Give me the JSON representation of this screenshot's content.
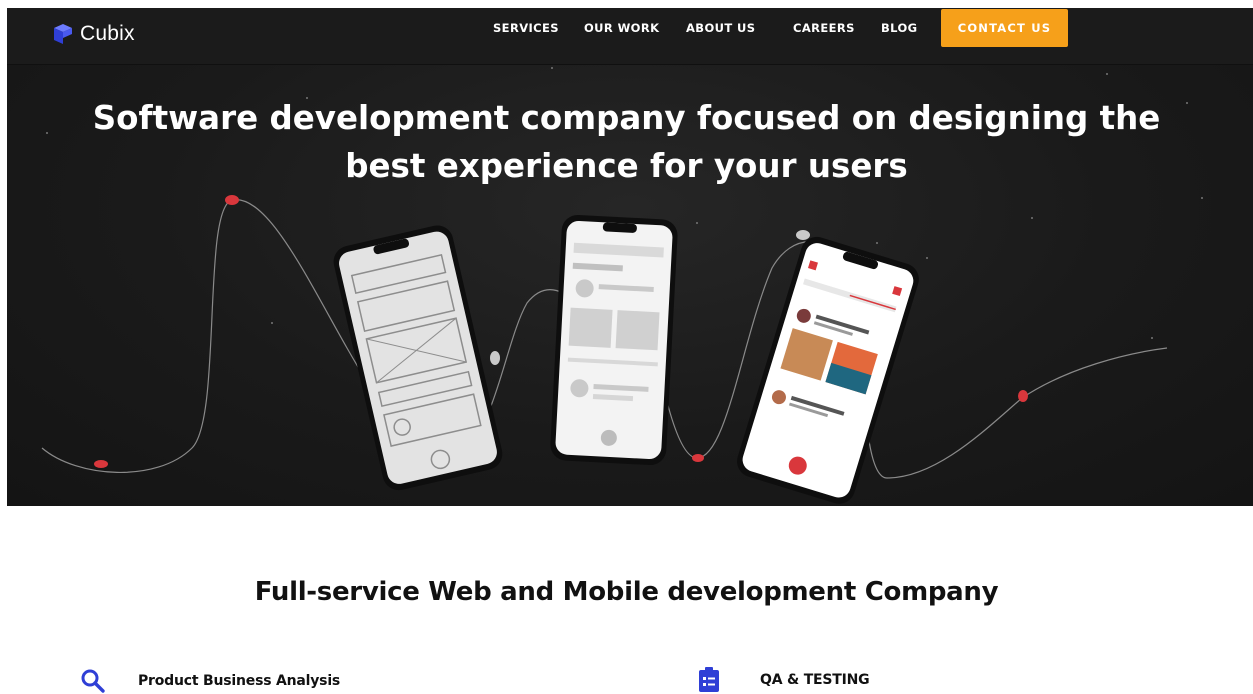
{
  "brand": {
    "name": "Cubix",
    "color": "#3d4cd8"
  },
  "nav": {
    "items": [
      "SERVICES",
      "OUR WORK",
      "ABOUT US",
      "CAREERS",
      "BLOG"
    ],
    "cta": "CONTACT US",
    "cta_color": "#f6a01a"
  },
  "hero": {
    "title_line1": "Software development company focused on designing the",
    "title_line2": "best experience for your users"
  },
  "section": {
    "title": "Full-service Web and Mobile development Company",
    "services": [
      {
        "label": "Product Business Analysis",
        "icon": "search-icon"
      },
      {
        "label": "QA & TESTING",
        "icon": "checklist-icon"
      }
    ]
  },
  "colors": {
    "accent_blue": "#2f3fd6",
    "hero_bg": "#1a1a1a",
    "curve_dot": "#d9373c"
  }
}
